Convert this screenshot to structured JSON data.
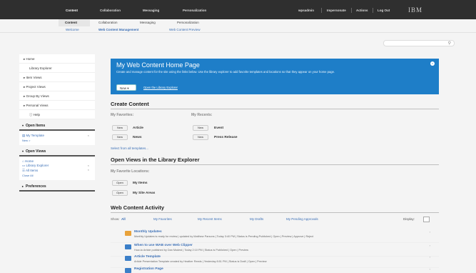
{
  "topbar": {
    "items": [
      "Content",
      "Collaboration",
      "Messaging",
      "Personalization"
    ],
    "right": [
      "wpsadmin",
      "Impersonate",
      "Actions",
      "Log Out"
    ],
    "brand": "IBM"
  },
  "subbar": {
    "items": [
      "Content",
      "Collaboration",
      "Messaging",
      "Personalization"
    ]
  },
  "thirdbar": {
    "items": [
      "Welcome",
      "Web Content Management",
      "Web Content Preview"
    ]
  },
  "search": {
    "placeholder": ""
  },
  "sidebar": {
    "nav": [
      "Home",
      "Library Explorer",
      "Item Views",
      "Project Views",
      "Group By Views",
      "Personal Views",
      "Help"
    ],
    "open_items": {
      "title": "Open Items",
      "items": [
        "My Template"
      ],
      "new": "New >"
    },
    "open_views": {
      "title": "Open Views",
      "items": [
        "Home",
        "Library Explorer",
        "All Items"
      ],
      "close_all": "Close All"
    },
    "preferences": "Preferences"
  },
  "banner": {
    "title": "My Web Content Home Page",
    "text": "Create and manage content for the site using the links below. Use the library explorer to add favorite templates and locations so that they appear on your home page.",
    "new_button": "New ▾",
    "open_link": "Open the Library Explorer"
  },
  "create": {
    "title": "Create Content",
    "favorites_label": "My Favorites:",
    "recents_label": "My Recents:",
    "favorites": [
      "Article",
      "News"
    ],
    "recents": [
      "Event",
      "Press Release"
    ],
    "new_label": "New",
    "select_link": "Select from all templates..."
  },
  "open_views_section": {
    "title": "Open Views in the Library Explorer",
    "locations_label": "My Favorite Locations:",
    "open_label": "Open",
    "locations": [
      "My Items",
      "My Site Areas"
    ]
  },
  "activity": {
    "title": "Web Content Activity",
    "show_label": "Show:",
    "filters": [
      "All",
      "My Favorites",
      "My Recent Items",
      "My Drafts",
      "My Pending Approvals"
    ],
    "display_label": "Display:",
    "items": [
      {
        "title": "Monthly Updates",
        "desc": "Monthly Updates is ready for review  |  updated by Matthew Parsons  |  Today 3:40 PM  |  Status is Pending Published  |  Open  |  Preview  |  Approve  |  Reject",
        "color": "#e8a23a"
      },
      {
        "title": "When to use WAB over Web Clipper",
        "desc": "How-to Article published by Dan Modest  |  Today 2:10 PM  |  Status is Published  |  Open  |  Preview",
        "color": "#3b7fc8"
      },
      {
        "title": "Article Template",
        "desc": "Article Presentation Template created by Heather Reeds  |  Yesterday 8:51 PM  |  Status is Draft  |  Open  |  Preview",
        "color": "#3b7fc8"
      },
      {
        "title": "Registration Page",
        "desc": "",
        "color": "#3b7fc8"
      }
    ]
  }
}
